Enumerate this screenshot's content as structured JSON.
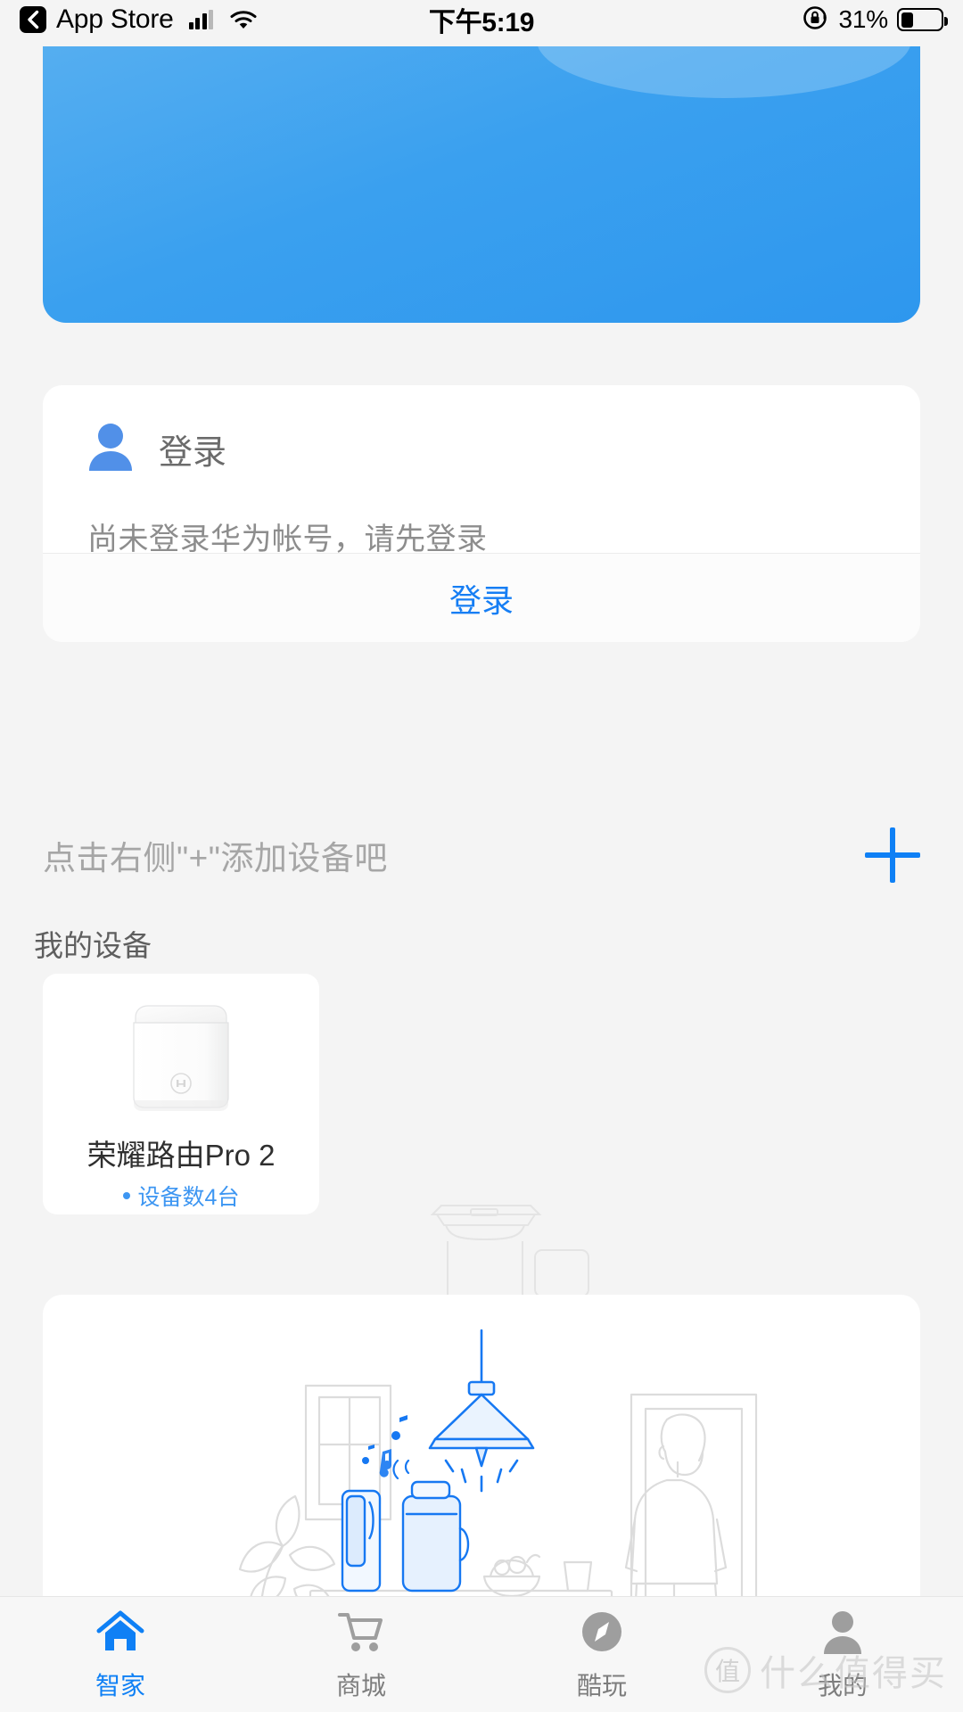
{
  "status_bar": {
    "back_icon": "back-chevron-icon",
    "carrier_label": "App Store",
    "signal_icon": "cellular-signal-icon",
    "wifi_icon": "wifi-icon",
    "time": "下午5:19",
    "rotation_lock_icon": "rotation-lock-icon",
    "battery_percent": "31%",
    "battery_icon": "battery-icon",
    "battery_level": 31
  },
  "banner": {
    "name": "promo-banner",
    "color": "#3aa0ef"
  },
  "login_card": {
    "avatar_icon": "person-icon",
    "title": "登录",
    "description": "尚未登录华为帐号，请先登录",
    "button_label": "登录",
    "accent_color": "#167ef4"
  },
  "add_device": {
    "hint": "点击右侧\"+\"添加设备吧",
    "plus_icon": "plus-icon",
    "plus_color": "#0f80f5"
  },
  "my_devices": {
    "section_title": "我的设备",
    "items": [
      {
        "name": "荣耀路由Pro 2",
        "status": "设备数4台",
        "device_icon": "router-icon",
        "status_color": "#3d96f2"
      }
    ]
  },
  "illustration": {
    "name": "smart-home-scene-illustration",
    "accent_color": "#1678f2",
    "line_color": "#d8d8d8",
    "elements": [
      "pendant-lamp",
      "smart-speaker",
      "kettle",
      "fruit-bowl",
      "glass",
      "table",
      "plant",
      "person",
      "door",
      "window",
      "music-notes"
    ]
  },
  "tab_bar": {
    "tabs": [
      {
        "label": "智家",
        "icon": "home-icon",
        "active": true
      },
      {
        "label": "商城",
        "icon": "cart-icon",
        "active": false
      },
      {
        "label": "酷玩",
        "icon": "compass-icon",
        "active": false
      },
      {
        "label": "我的",
        "icon": "person-icon",
        "active": false
      }
    ],
    "active_color": "#0f80f5",
    "inactive_color": "#9e9e9e"
  },
  "watermark": {
    "mark": "值",
    "text": "什么值得买"
  }
}
